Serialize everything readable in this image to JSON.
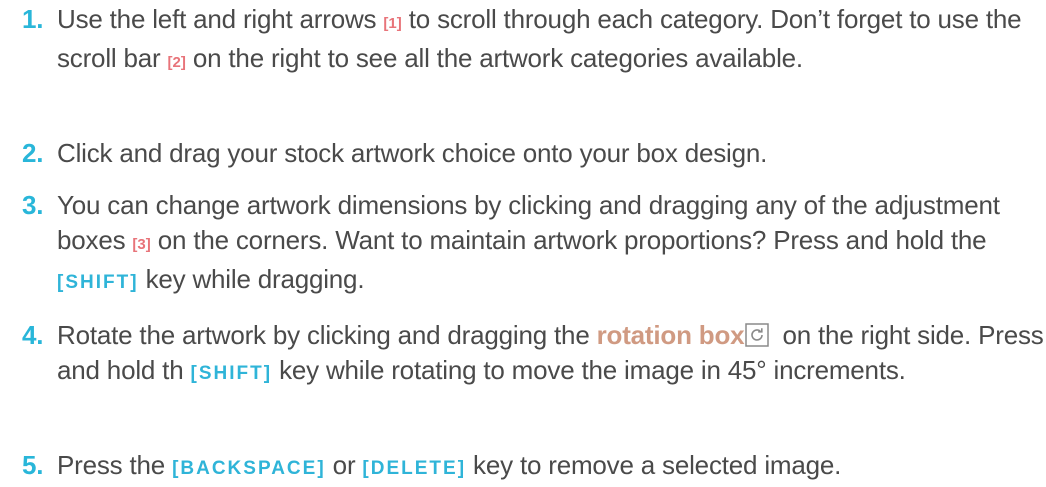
{
  "steps": [
    {
      "number": "1.",
      "text_a": "Use the left and right arrows ",
      "ref_a": "[1]",
      "text_b": " to scroll through each category. Don’t forget to use the scroll bar ",
      "ref_b": "[2]",
      "text_c": " on the right to see all the artwork categories available."
    },
    {
      "number": "2.",
      "text": "Click and drag your stock artwork choice onto your box design."
    },
    {
      "number": "3.",
      "text_a": "You can change artwork dimensions by clicking and dragging any of the adjustment boxes ",
      "ref": "[3]",
      "text_b": " on the corners. Want to maintain artwork proportions? Press and hold the ",
      "key": "[SHIFT]",
      "text_c": " key while dragging."
    },
    {
      "number": "4.",
      "text_a": "Rotate the artwork by clicking and dragging the ",
      "highlight": "rotation box",
      "icon": "rotate-icon",
      "text_b": " on the right side. Press and hold th ",
      "key": "[SHIFT]",
      "text_c": " key while rotating to move the image in 45° increments."
    },
    {
      "number": "5.",
      "text_a": "Press the ",
      "key_a": "[BACKSPACE]",
      "text_b": " or ",
      "key_b": "[DELETE]",
      "text_c": " key to remove a selected image."
    }
  ],
  "colors": {
    "number": "#29b6d9",
    "reference": "#e8747a",
    "key": "#2fb4d8",
    "highlight": "#d09a82",
    "text": "#4a4a4a"
  }
}
